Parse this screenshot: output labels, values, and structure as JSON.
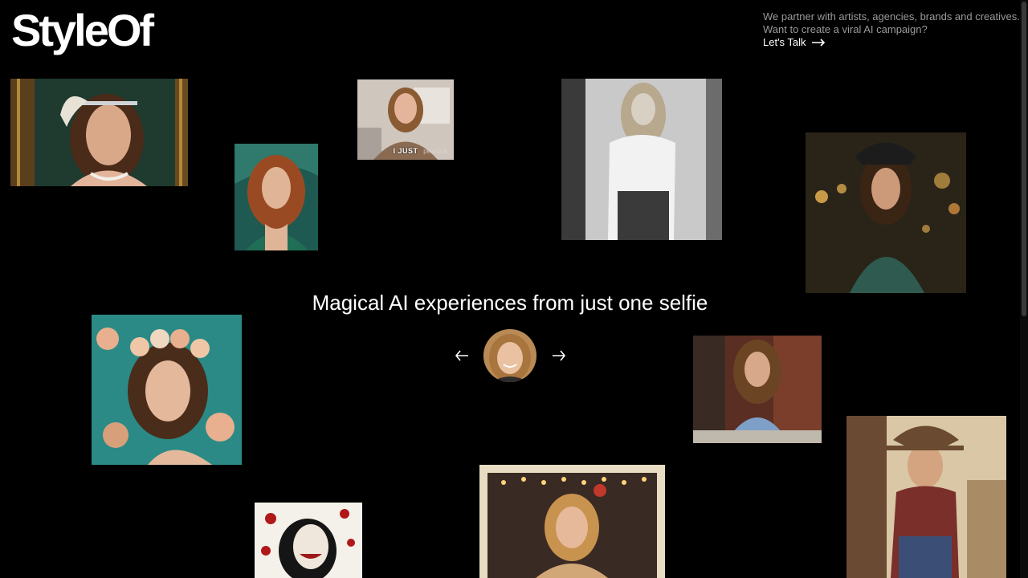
{
  "brand": {
    "logo": "StyleOf"
  },
  "pitch": {
    "line1": "We partner with artists, agencies, brands and creatives.",
    "line2": "Want to create a viral AI campaign?",
    "cta": "Let's Talk"
  },
  "hero": {
    "headline": "Magical AI experiences from just one selfie"
  },
  "gallery": {
    "gif_caption": "I JUST",
    "gif_watermark": "peacock"
  }
}
